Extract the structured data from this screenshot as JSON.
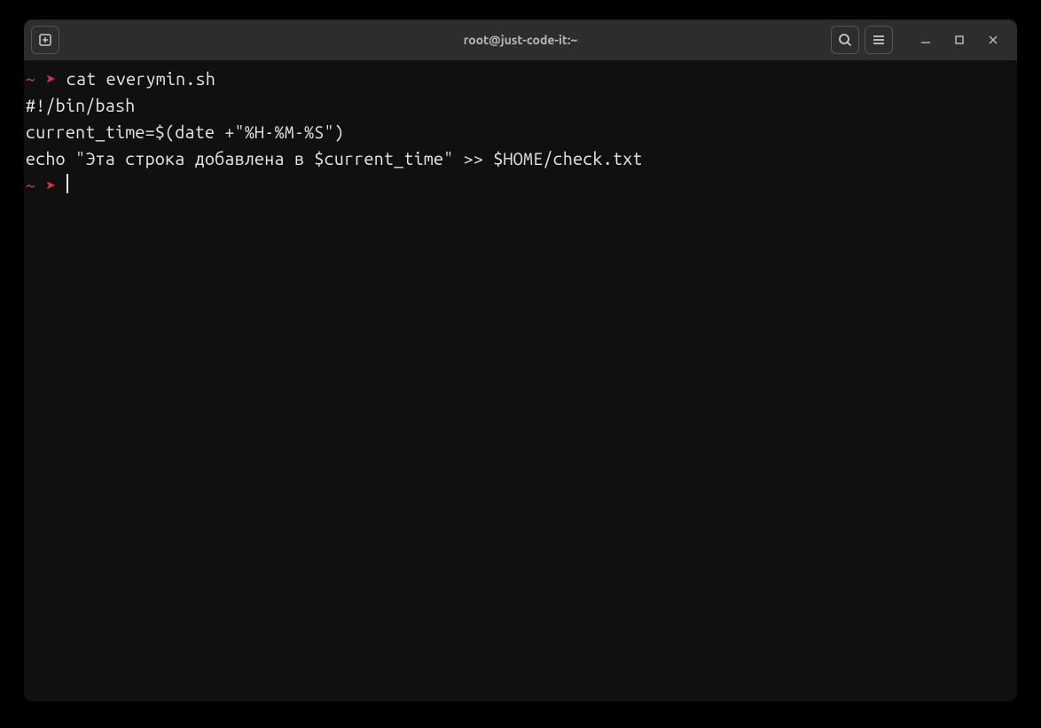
{
  "titlebar": {
    "title": "root@just-code-it:~"
  },
  "prompt": {
    "cwd": "~",
    "arrow": "➤"
  },
  "terminal": {
    "command1": "cat everymin.sh",
    "output_line1": "#!/bin/bash",
    "output_line2": "current_time=$(date +\"%H-%M-%S\")",
    "output_line3": "echo \"Эта строка добавлена в $current_time\" >> $HOME/check.txt"
  }
}
